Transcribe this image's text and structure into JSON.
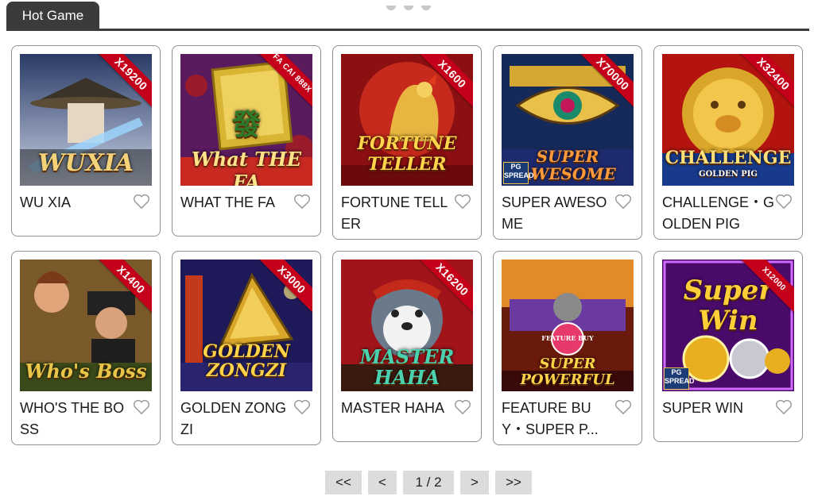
{
  "tabs": {
    "active_label": "Hot Game"
  },
  "games": [
    {
      "title": "WU XIA",
      "multiplier": "X19200",
      "logo": "WUXIA"
    },
    {
      "title": "WHAT THE FA",
      "multiplier": "FA CAI 888X",
      "logo": "What THE FA"
    },
    {
      "title": "FORTUNE TELLER",
      "multiplier": "X1600",
      "logo": "FORTUNE TELLER"
    },
    {
      "title": "SUPER AWESOME",
      "multiplier": "X70000",
      "logo": "SUPER AWESOME"
    },
    {
      "title": "CHALLENGE・GOLDEN PIG",
      "multiplier": "X32400",
      "logo": "CHALLENGE"
    },
    {
      "title": "WHO'S THE BOSS",
      "multiplier": "X1400",
      "logo": "Who's Boss"
    },
    {
      "title": "GOLDEN ZONGZI",
      "multiplier": "X3000",
      "logo": "GOLDEN ZONGZI"
    },
    {
      "title": "MASTER HAHA",
      "multiplier": "X16200",
      "logo": "MASTER HAHA"
    },
    {
      "title": "FEATURE BUY・SUPER P...",
      "multiplier": "",
      "logo": "SUPER POWERFUL"
    },
    {
      "title": "SUPER WIN",
      "multiplier": "X12000",
      "logo": "Super Win"
    }
  ],
  "pagination": {
    "first_label": "<<",
    "prev_label": "<",
    "page_indicator": "1 / 2",
    "next_label": ">",
    "last_label": ">>"
  },
  "badges": {
    "pg_spread": "PG SPREAD",
    "feature_buy": "FEATURE BUY",
    "golden_pig": "GOLDEN PIG"
  },
  "colors": {
    "tab_bg": "#3b3b3b",
    "ribbon": "#c4001a",
    "pager_bg": "#dcdcdc"
  }
}
